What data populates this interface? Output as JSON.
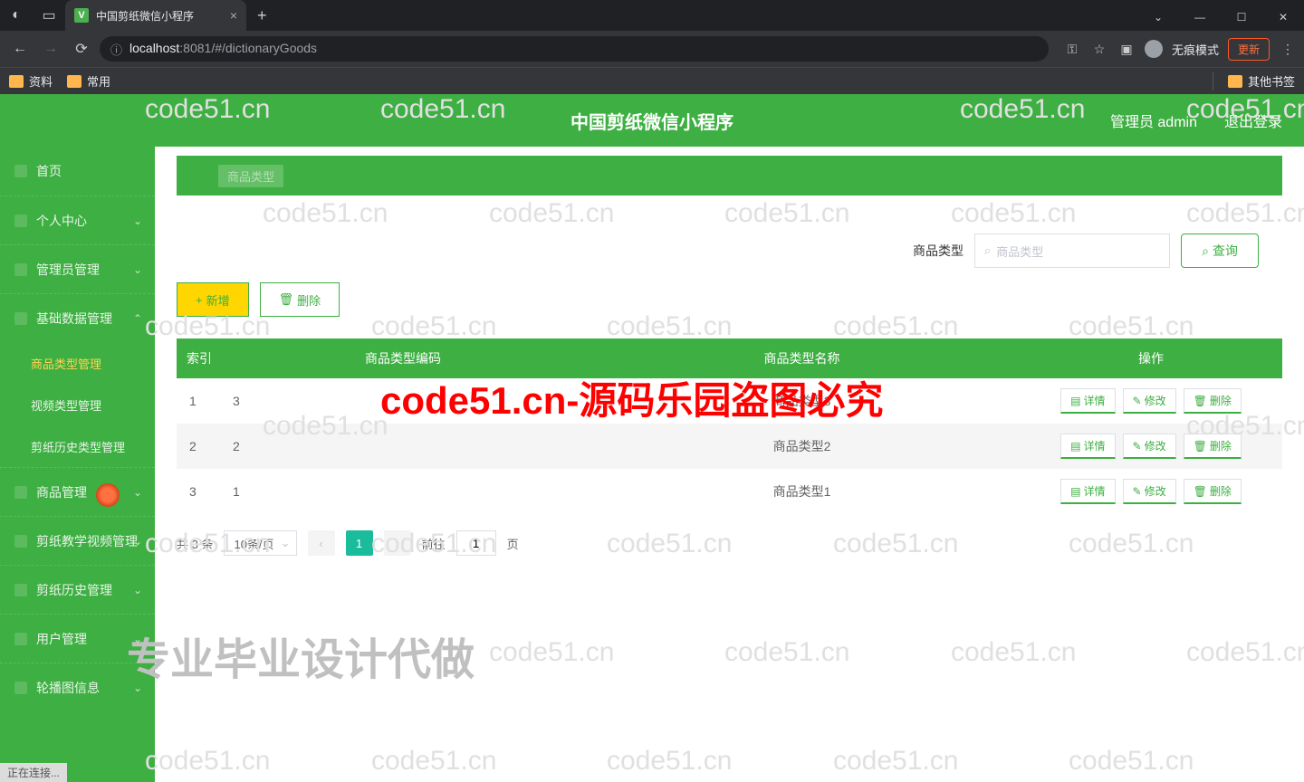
{
  "browser": {
    "tab_title": "中国剪纸微信小程序",
    "tab_favicon": "V",
    "url_host": "localhost",
    "url_port_path": ":8081/#/dictionaryGoods",
    "incognito": "无痕模式",
    "update": "更新",
    "bookmarks": [
      "资料",
      "常用"
    ],
    "other_bookmarks": "其他书签"
  },
  "header": {
    "title": "中国剪纸微信小程序",
    "user": "管理员 admin",
    "logout": "退出登录"
  },
  "sidebar": {
    "items": [
      {
        "label": "首页",
        "kind": "item"
      },
      {
        "label": "个人中心",
        "kind": "item",
        "chevron": "⌄"
      },
      {
        "label": "管理员管理",
        "kind": "item",
        "chevron": "⌄"
      },
      {
        "label": "基础数据管理",
        "kind": "item",
        "chevron": "⌃"
      },
      {
        "label": "商品类型管理",
        "kind": "sub",
        "active": true
      },
      {
        "label": "视频类型管理",
        "kind": "sub"
      },
      {
        "label": "剪纸历史类型管理",
        "kind": "sub"
      },
      {
        "label": "商品管理",
        "kind": "item",
        "chevron": "⌄"
      },
      {
        "label": "剪纸教学视频管理",
        "kind": "item",
        "chevron": "⌄"
      },
      {
        "label": "剪纸历史管理",
        "kind": "item",
        "chevron": "⌄"
      },
      {
        "label": "用户管理",
        "kind": "item",
        "chevron": "⌄"
      },
      {
        "label": "轮播图信息",
        "kind": "item",
        "chevron": "⌄"
      }
    ]
  },
  "breadcrumb": "商品类型",
  "filter": {
    "label": "商品类型",
    "placeholder": "商品类型",
    "query": "查询"
  },
  "actions": {
    "add": "新增",
    "delete": "删除"
  },
  "table": {
    "headers": {
      "index": "索引",
      "code": "商品类型编码",
      "name": "商品类型名称",
      "ops": "操作"
    },
    "ops": {
      "detail": "详情",
      "edit": "修改",
      "delete": "删除"
    },
    "rows": [
      {
        "index": "1",
        "code": "3",
        "name": "商品类型3"
      },
      {
        "index": "2",
        "code": "2",
        "name": "商品类型2"
      },
      {
        "index": "3",
        "code": "1",
        "name": "商品类型1"
      }
    ]
  },
  "pagination": {
    "total": "共 3 条",
    "per_page": "10条/页",
    "current": "1",
    "goto": "前往",
    "goto_val": "1",
    "page_suffix": "页"
  },
  "status": "正在连接...",
  "watermarks": {
    "grey": "code51.cn",
    "red": "code51.cn-源码乐园盗图必究",
    "big": "专业毕业设计代做"
  }
}
